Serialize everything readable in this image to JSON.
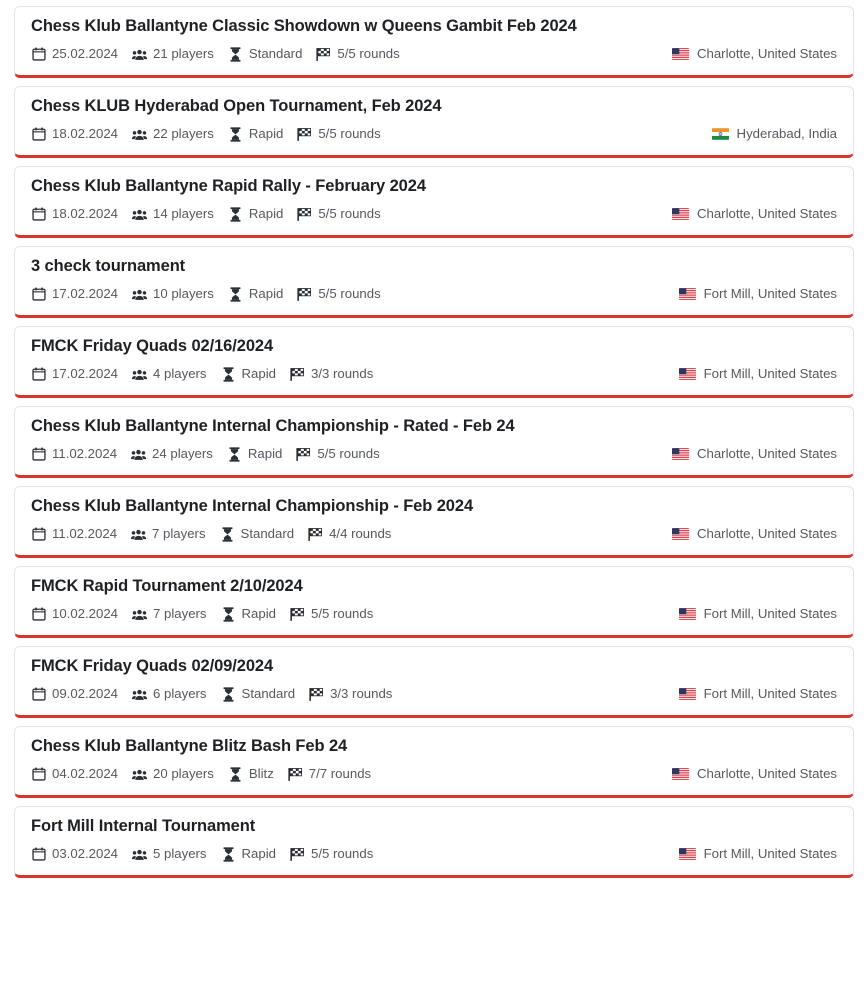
{
  "colors": {
    "card_border": "#e2e3e5",
    "card_accent_bottom": "#d9352c",
    "title_text": "#1d2125",
    "meta_text": "#53595f",
    "page_background": "#ffffff"
  },
  "icons": {
    "date": "calendar-icon",
    "players": "users-icon",
    "time_control": "hourglass-icon",
    "rounds": "checkered-flag-icon",
    "flag_us": "flag-united-states-icon",
    "flag_in": "flag-india-icon"
  },
  "tournaments": [
    {
      "title": "Chess Klub Ballantyne Classic Showdown w Queens Gambit Feb 2024",
      "date": "25.02.2024",
      "players": "21 players",
      "time_control": "Standard",
      "rounds": "5/5 rounds",
      "location": "Charlotte, United States",
      "flag": "us"
    },
    {
      "title": "Chess KLUB Hyderabad Open Tournament, Feb 2024",
      "date": "18.02.2024",
      "players": "22 players",
      "time_control": "Rapid",
      "rounds": "5/5 rounds",
      "location": "Hyderabad, India",
      "flag": "in"
    },
    {
      "title": "Chess Klub Ballantyne Rapid Rally - February 2024",
      "date": "18.02.2024",
      "players": "14 players",
      "time_control": "Rapid",
      "rounds": "5/5 rounds",
      "location": "Charlotte, United States",
      "flag": "us"
    },
    {
      "title": "3 check tournament",
      "date": "17.02.2024",
      "players": "10 players",
      "time_control": "Rapid",
      "rounds": "5/5 rounds",
      "location": "Fort Mill, United States",
      "flag": "us"
    },
    {
      "title": "FMCK Friday Quads 02/16/2024",
      "date": "17.02.2024",
      "players": "4 players",
      "time_control": "Rapid",
      "rounds": "3/3 rounds",
      "location": "Fort Mill, United States",
      "flag": "us"
    },
    {
      "title": "Chess Klub Ballantyne Internal Championship - Rated - Feb 24",
      "date": "11.02.2024",
      "players": "24 players",
      "time_control": "Rapid",
      "rounds": "5/5 rounds",
      "location": "Charlotte, United States",
      "flag": "us"
    },
    {
      "title": "Chess Klub Ballantyne Internal Championship - Feb 2024",
      "date": "11.02.2024",
      "players": "7 players",
      "time_control": "Standard",
      "rounds": "4/4 rounds",
      "location": "Charlotte, United States",
      "flag": "us"
    },
    {
      "title": "FMCK Rapid Tournament 2/10/2024",
      "date": "10.02.2024",
      "players": "7 players",
      "time_control": "Rapid",
      "rounds": "5/5 rounds",
      "location": "Fort Mill, United States",
      "flag": "us"
    },
    {
      "title": "FMCK Friday Quads 02/09/2024",
      "date": "09.02.2024",
      "players": "6 players",
      "time_control": "Standard",
      "rounds": "3/3 rounds",
      "location": "Fort Mill, United States",
      "flag": "us"
    },
    {
      "title": "Chess Klub Ballantyne Blitz Bash Feb 24",
      "date": "04.02.2024",
      "players": "20 players",
      "time_control": "Blitz",
      "rounds": "7/7 rounds",
      "location": "Charlotte, United States",
      "flag": "us"
    },
    {
      "title": "Fort Mill Internal Tournament",
      "date": "03.02.2024",
      "players": "5 players",
      "time_control": "Rapid",
      "rounds": "5/5 rounds",
      "location": "Fort Mill, United States",
      "flag": "us"
    }
  ]
}
